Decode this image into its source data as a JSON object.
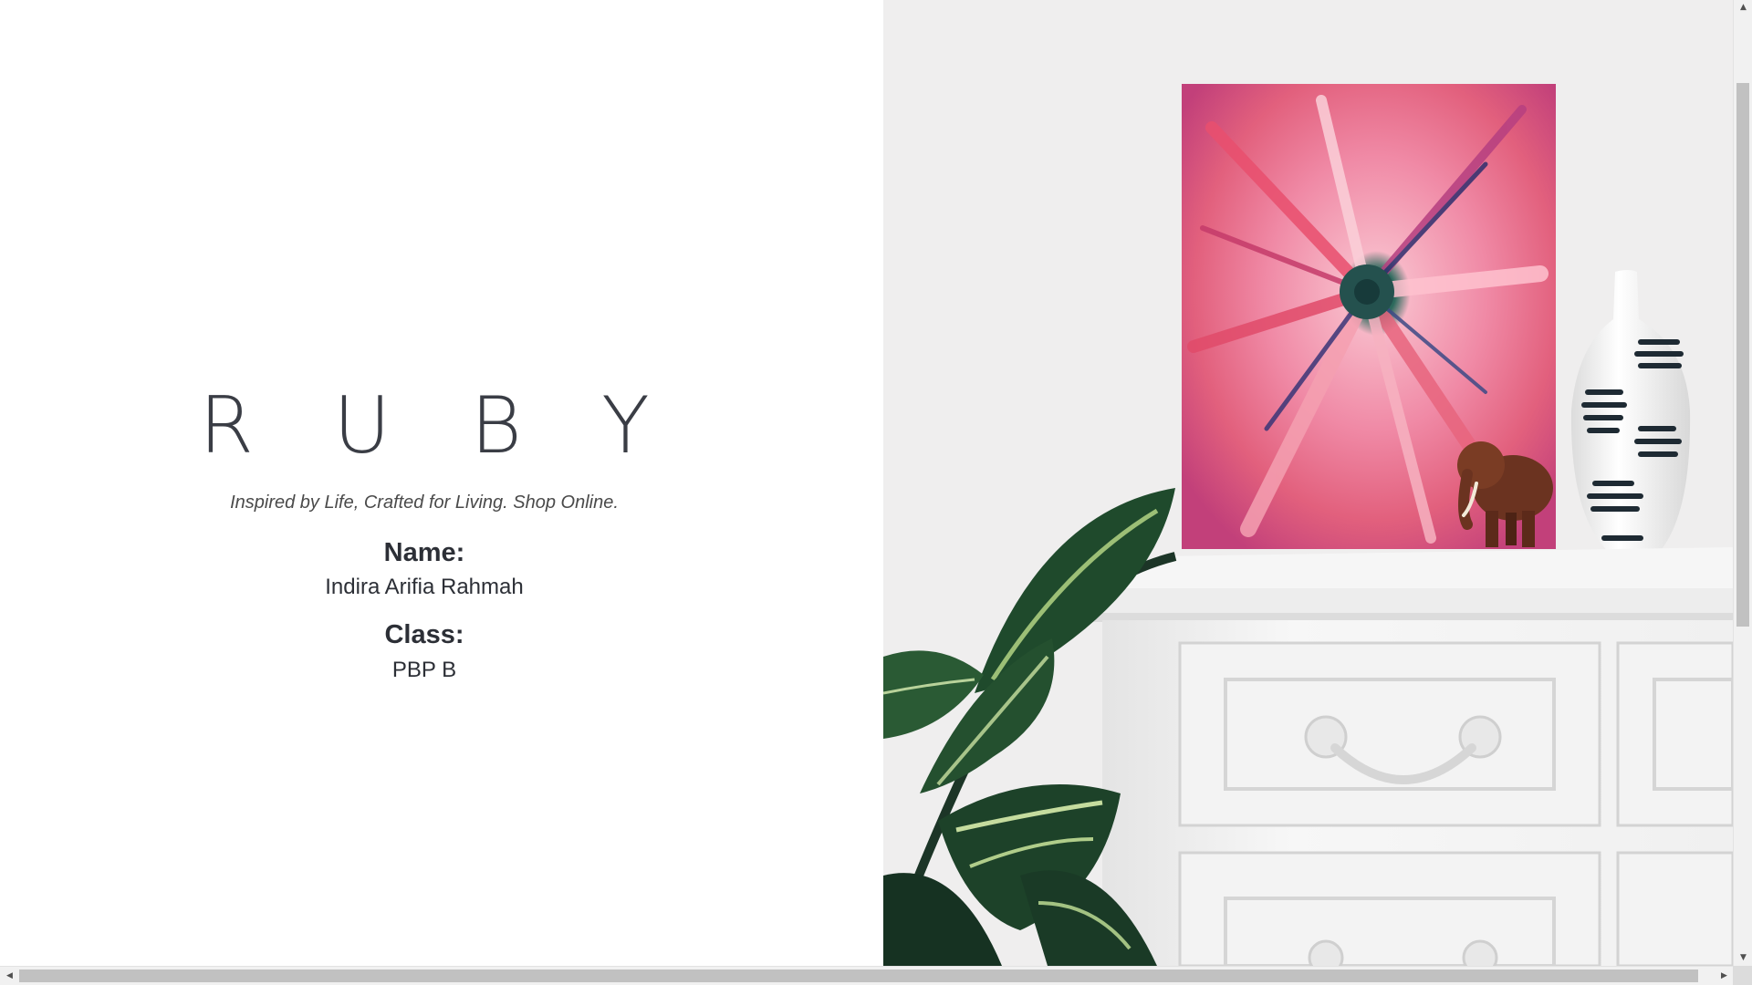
{
  "hero": {
    "brand": "R U B Y",
    "tagline": "Inspired by Life, Crafted for Living. Shop Online.",
    "name_label": "Name:",
    "name_value": "Indira Arifia Rahmah",
    "class_label": "Class:",
    "class_value": "PBP B"
  },
  "image": {
    "icon": "still-life-photo",
    "colors": {
      "wall": "#efeeee",
      "dresser": "#f4f4f4",
      "painting_pink": "#f08aa6",
      "painting_magenta": "#c2407a",
      "leaf_dark": "#1f3b2a",
      "leaf_light": "#a8c48a",
      "elephant": "#6b3320"
    }
  },
  "scrollbars": {
    "up_arrow": "▲",
    "down_arrow": "▼",
    "left_arrow": "◀",
    "right_arrow": "▶"
  }
}
